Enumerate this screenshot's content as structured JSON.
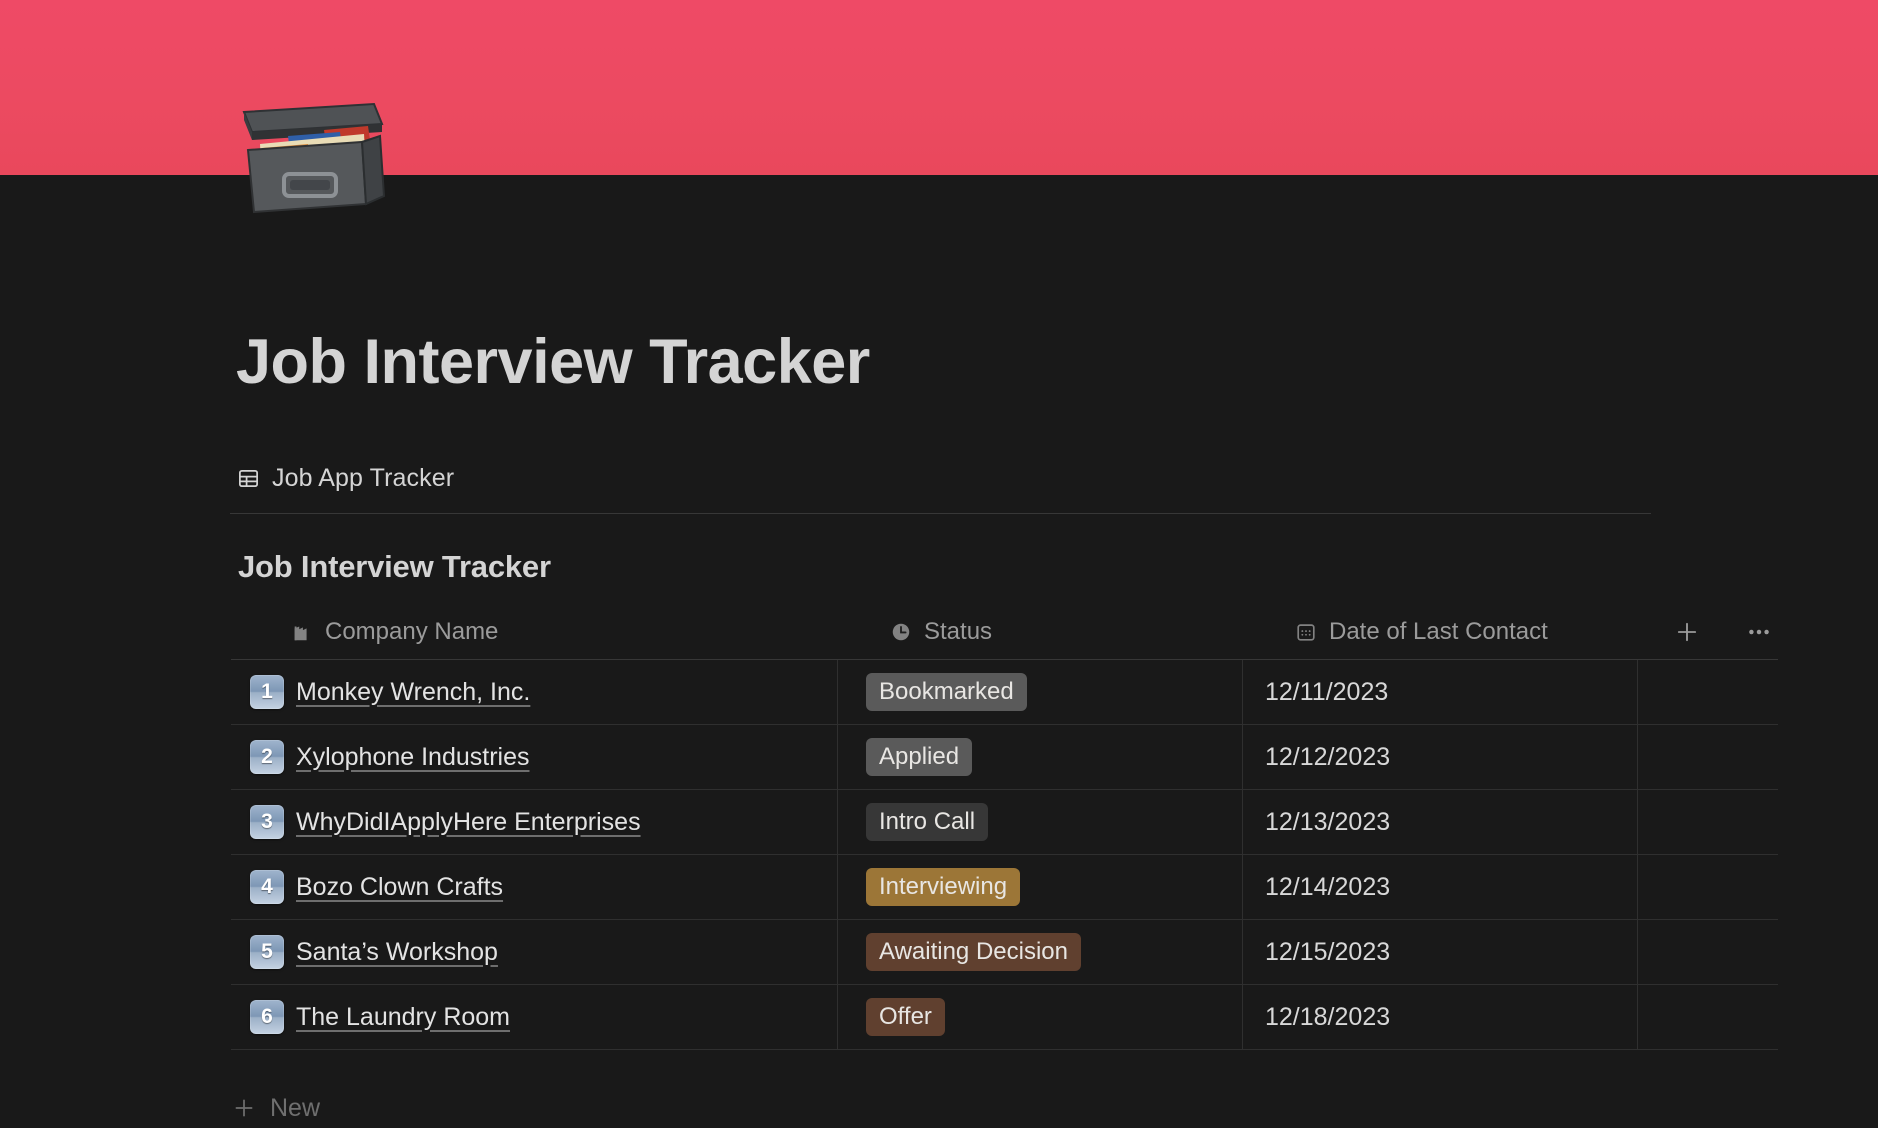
{
  "cover": {
    "color_top": "#ef4a66",
    "color_bottom": "#e9485c"
  },
  "page_icon": "card-file-box-emoji",
  "header": {
    "title": "Job Interview Tracker"
  },
  "breadcrumb": {
    "icon": "table-icon",
    "label": "Job App Tracker"
  },
  "database": {
    "title": "Job Interview Tracker",
    "columns": [
      {
        "label": "Company Name",
        "icon": "building-icon"
      },
      {
        "label": "Status",
        "icon": "clock-icon"
      },
      {
        "label": "Date of Last Contact",
        "icon": "calendar-icon"
      }
    ],
    "header_actions": [
      {
        "name": "add-column-button",
        "icon": "plus-icon"
      },
      {
        "name": "more-options-button",
        "icon": "ellipsis-icon"
      }
    ],
    "rows": [
      {
        "number": "1",
        "company": "Monkey Wrench, Inc.",
        "status": "Bookmarked",
        "status_bg": "#5a5a5a",
        "date": "12/11/2023"
      },
      {
        "number": "2",
        "company": "Xylophone Industries",
        "status": "Applied",
        "status_bg": "#5a5a5a",
        "date": "12/12/2023"
      },
      {
        "number": "3",
        "company": "WhyDidIApplyHere Enterprises",
        "status": "Intro Call",
        "status_bg": "#373737",
        "date": "12/13/2023"
      },
      {
        "number": "4",
        "company": "Bozo Clown Crafts",
        "status": "Interviewing",
        "status_bg": "#9c7637",
        "date": "12/14/2023"
      },
      {
        "number": "5",
        "company": "Santa’s Workshop",
        "status": "Awaiting Decision",
        "status_bg": "#60402f",
        "date": "12/15/2023"
      },
      {
        "number": "6",
        "company": "The Laundry Room",
        "status": "Offer",
        "status_bg": "#60402f",
        "date": "12/18/2023"
      }
    ],
    "new_row": {
      "icon": "plus-icon",
      "label": "New"
    }
  }
}
